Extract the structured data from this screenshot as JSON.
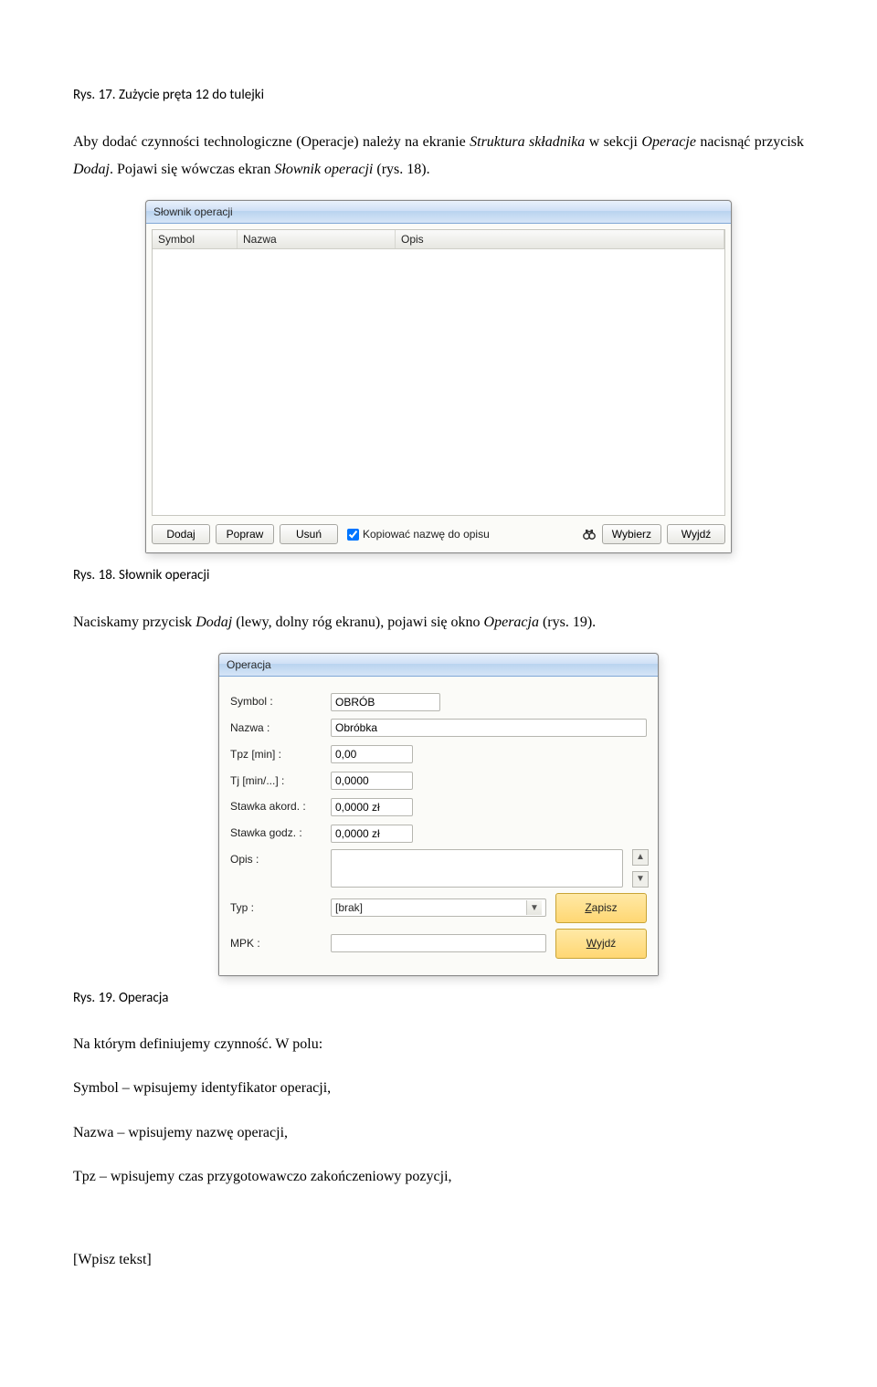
{
  "caption_17": "Rys. 17. Zużycie pręta 12 do tulejki",
  "para_1_a": "Aby dodać czynności technologiczne (Operacje) należy na ekranie ",
  "para_1_i1": "Struktura składnika",
  "para_1_b": " w sekcji ",
  "para_1_i2": "Operacje",
  "para_1_c": " nacisnąć przycisk ",
  "para_1_i3": "Dodaj",
  "para_1_d": ". Pojawi się wówczas ekran ",
  "para_1_i4": "Słownik operacji",
  "para_1_e": " (rys. 18).",
  "dlg18": {
    "title": "Słownik operacji",
    "columns": [
      "Symbol",
      "Nazwa",
      "Opis"
    ],
    "buttons": {
      "add": "Dodaj",
      "edit": "Popraw",
      "del": "Usuń",
      "select": "Wybierz",
      "exit": "Wyjdź"
    },
    "checkbox": "Kopiować nazwę do opisu"
  },
  "caption_18": "Rys. 18. Słownik operacji",
  "para_2_a": "Naciskamy przycisk ",
  "para_2_i1": "Dodaj",
  "para_2_b": " (lewy, dolny róg ekranu), pojawi się okno ",
  "para_2_i2": "Operacja",
  "para_2_c": " (rys. 19).",
  "dlg19": {
    "title": "Operacja",
    "labels": {
      "symbol": "Symbol :",
      "nazwa": "Nazwa :",
      "tpz": "Tpz [min] :",
      "tj": "Tj [min/...] :",
      "stawka_akord": "Stawka akord. :",
      "stawka_godz": "Stawka godz. :",
      "opis": "Opis :",
      "typ": "Typ :",
      "mpk": "MPK :"
    },
    "values": {
      "symbol": "OBRÓB",
      "nazwa": "Obróbka",
      "tpz": "0,00",
      "tj": "0,0000",
      "stawka_akord": "0,0000 zł",
      "stawka_godz": "0,0000 zł",
      "opis": "",
      "typ": "[brak]",
      "mpk": ""
    },
    "buttons": {
      "save_u": "Z",
      "save_rest": "apisz",
      "exit_u": "W",
      "exit_rest": "yjdź"
    }
  },
  "caption_19": "Rys. 19. Operacja",
  "para_3": "Na którym definiujemy czynność. W polu:",
  "defs": {
    "symbol": "Symbol – wpisujemy identyfikator operacji,",
    "nazwa": "Nazwa – wpisujemy nazwę operacji,",
    "tpz": "Tpz – wpisujemy czas przygotowawczo zakończeniowy pozycji,"
  },
  "footer": "[Wpisz tekst]"
}
